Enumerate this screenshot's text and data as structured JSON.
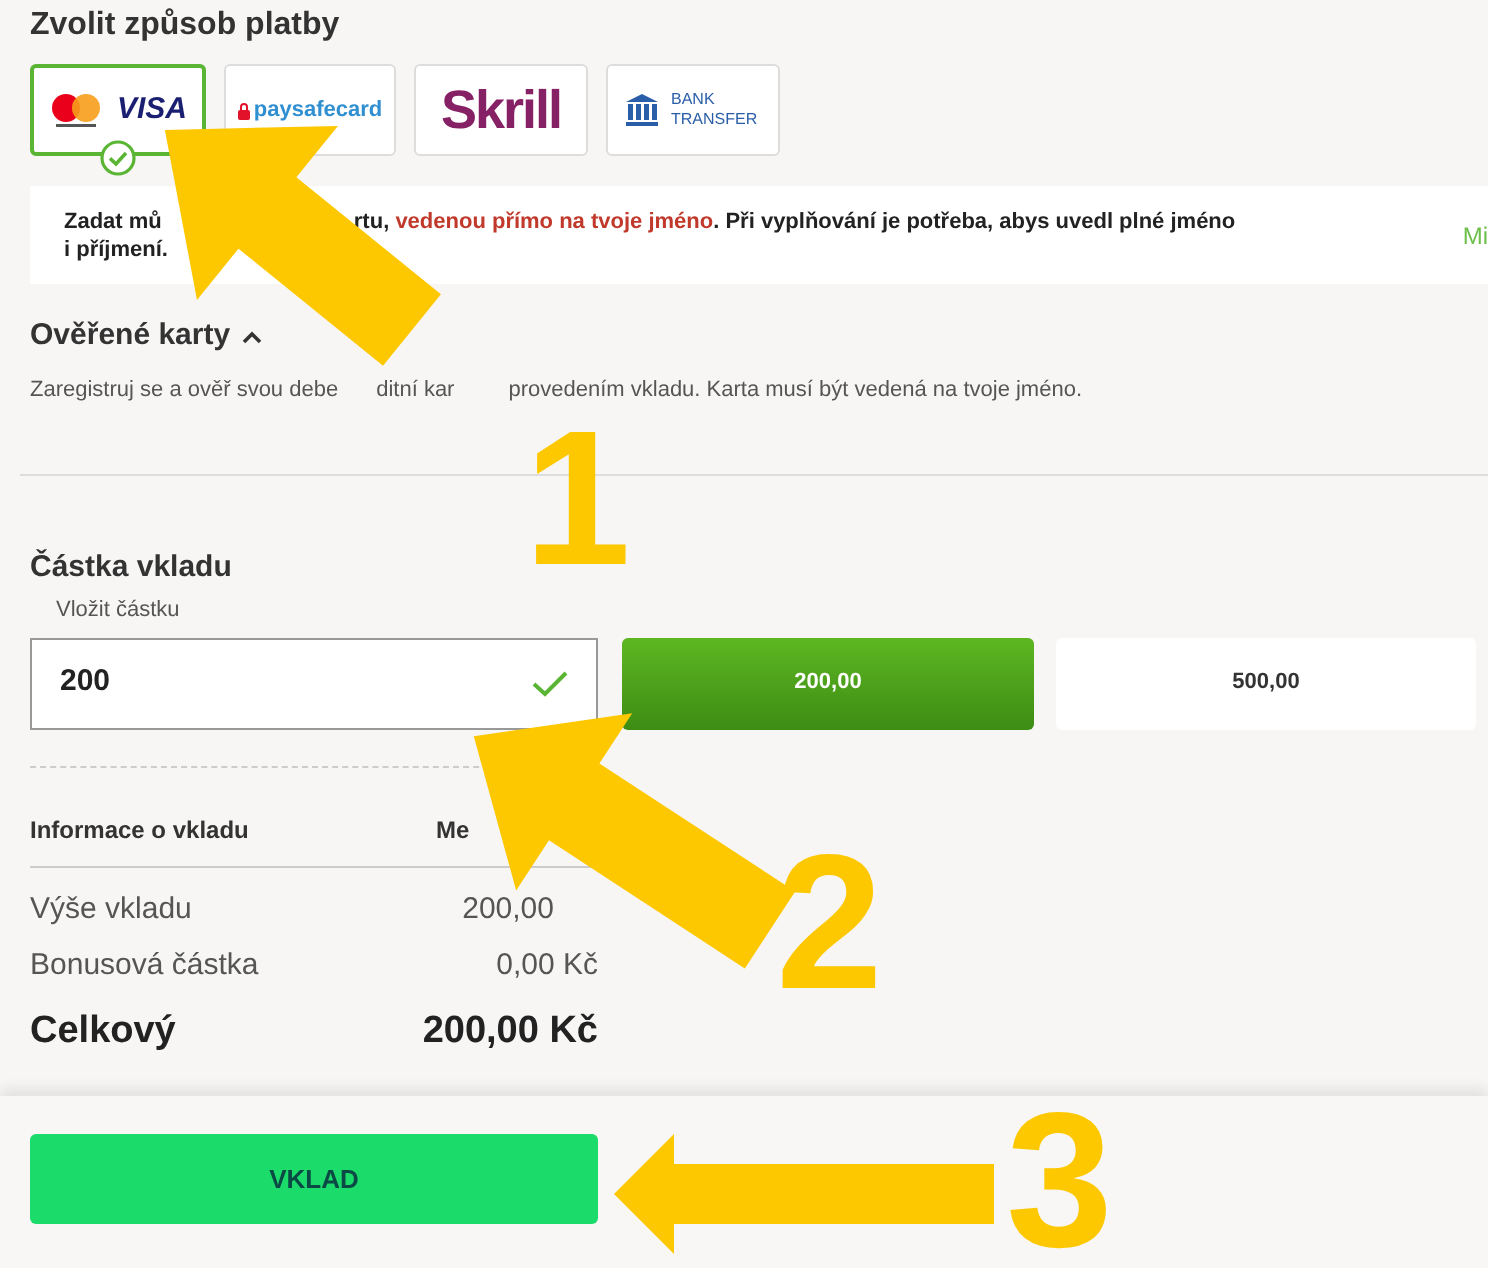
{
  "payment": {
    "title": "Zvolit způsob platby",
    "methods": [
      {
        "kind": "cards",
        "label": "VISA",
        "selected": true
      },
      {
        "kind": "paysafecard",
        "label": "paysafecard",
        "selected": false
      },
      {
        "kind": "skrill",
        "label": "Skrill",
        "selected": false
      },
      {
        "kind": "bank",
        "label": "BANK TRANSFER",
        "selected": false
      }
    ]
  },
  "notice": {
    "start": "Zadat mů",
    "rest_before": "rtu, ",
    "highlight": "vedenou přímo na tvoje jméno",
    "rest_after": ". Při vyplňování je potřeba, abys uvedl plné jméno",
    "line2": "i příjmení.",
    "link": "Mi"
  },
  "verified_cards": {
    "title": "Ověřené karty",
    "expanded": true,
    "description_parts": [
      "Zaregistruj se a ověř svou debe",
      "ditní kar",
      "provedením vkladu. Karta musí být vedená na tvoje jméno."
    ]
  },
  "amount": {
    "title": "Částka vkladu",
    "field_label": "Vložit částku",
    "value": "200",
    "valid": true,
    "presets": [
      {
        "label": "200,00",
        "selected": true
      },
      {
        "label": "500,00",
        "selected": false
      }
    ]
  },
  "summary": {
    "columns": [
      "Informace o vkladu",
      "Me"
    ],
    "rows": [
      {
        "kind": "normal",
        "label": "Výše vkladu",
        "value": "200,00"
      },
      {
        "kind": "normal",
        "label": "Bonusová částka",
        "value": "0,00 Kč"
      },
      {
        "kind": "total",
        "label": "Celkový",
        "value": "200,00 Kč"
      }
    ]
  },
  "submit": {
    "label": "VKLAD"
  },
  "annotations": [
    {
      "label": "1"
    },
    {
      "label": "2"
    },
    {
      "label": "3"
    }
  ]
}
